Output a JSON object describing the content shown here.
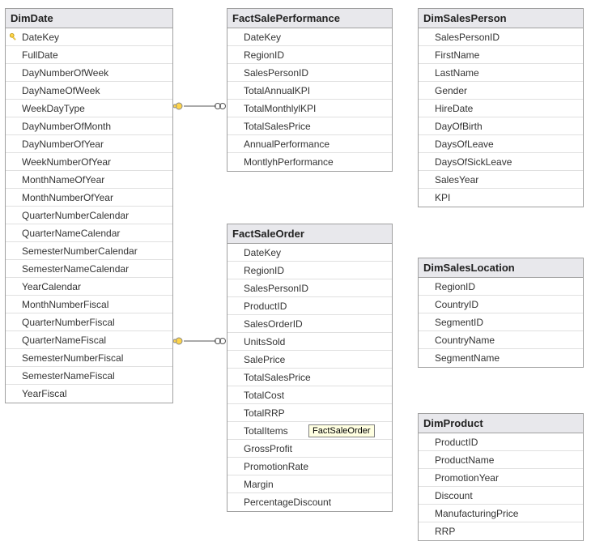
{
  "tables": {
    "dimDate": {
      "title": "DimDate",
      "columns": [
        {
          "name": "DateKey",
          "pk": true
        },
        {
          "name": "FullDate"
        },
        {
          "name": "DayNumberOfWeek"
        },
        {
          "name": "DayNameOfWeek"
        },
        {
          "name": "WeekDayType"
        },
        {
          "name": "DayNumberOfMonth"
        },
        {
          "name": "DayNumberOfYear"
        },
        {
          "name": "WeekNumberOfYear"
        },
        {
          "name": "MonthNameOfYear"
        },
        {
          "name": "MonthNumberOfYear"
        },
        {
          "name": "QuarterNumberCalendar"
        },
        {
          "name": "QuarterNameCalendar"
        },
        {
          "name": "SemesterNumberCalendar"
        },
        {
          "name": "SemesterNameCalendar"
        },
        {
          "name": "YearCalendar"
        },
        {
          "name": "MonthNumberFiscal"
        },
        {
          "name": "QuarterNumberFiscal"
        },
        {
          "name": "QuarterNameFiscal"
        },
        {
          "name": "SemesterNumberFiscal"
        },
        {
          "name": "SemesterNameFiscal"
        },
        {
          "name": "YearFiscal"
        }
      ]
    },
    "factSalePerformance": {
      "title": "FactSalePerformance",
      "columns": [
        {
          "name": "DateKey"
        },
        {
          "name": "RegionID"
        },
        {
          "name": "SalesPersonID"
        },
        {
          "name": "TotalAnnualKPI"
        },
        {
          "name": "TotalMonthlylKPI"
        },
        {
          "name": "TotalSalesPrice"
        },
        {
          "name": "AnnualPerformance"
        },
        {
          "name": "MontlyhPerformance"
        }
      ]
    },
    "factSaleOrder": {
      "title": "FactSaleOrder",
      "columns": [
        {
          "name": "DateKey"
        },
        {
          "name": "RegionID"
        },
        {
          "name": "SalesPersonID"
        },
        {
          "name": "ProductID"
        },
        {
          "name": "SalesOrderID"
        },
        {
          "name": "UnitsSold"
        },
        {
          "name": "SalePrice"
        },
        {
          "name": "TotalSalesPrice"
        },
        {
          "name": "TotalCost"
        },
        {
          "name": "TotalRRP"
        },
        {
          "name": "TotalItems"
        },
        {
          "name": "GrossProfit"
        },
        {
          "name": "PromotionRate"
        },
        {
          "name": "Margin"
        },
        {
          "name": "PercentageDiscount"
        }
      ]
    },
    "dimSalesPerson": {
      "title": "DimSalesPerson",
      "columns": [
        {
          "name": "SalesPersonID"
        },
        {
          "name": "FirstName"
        },
        {
          "name": "LastName"
        },
        {
          "name": "Gender"
        },
        {
          "name": "HireDate"
        },
        {
          "name": "DayOfBirth"
        },
        {
          "name": "DaysOfLeave"
        },
        {
          "name": "DaysOfSickLeave"
        },
        {
          "name": "SalesYear"
        },
        {
          "name": "KPI"
        }
      ]
    },
    "dimSalesLocation": {
      "title": "DimSalesLocation",
      "columns": [
        {
          "name": "RegionID"
        },
        {
          "name": "CountryID"
        },
        {
          "name": "SegmentID"
        },
        {
          "name": "CountryName"
        },
        {
          "name": "SegmentName"
        }
      ]
    },
    "dimProduct": {
      "title": "DimProduct",
      "columns": [
        {
          "name": "ProductID"
        },
        {
          "name": "ProductName"
        },
        {
          "name": "PromotionYear"
        },
        {
          "name": "Discount"
        },
        {
          "name": "ManufacturingPrice"
        },
        {
          "name": "RRP"
        }
      ]
    }
  },
  "tooltip": "FactSaleOrder"
}
